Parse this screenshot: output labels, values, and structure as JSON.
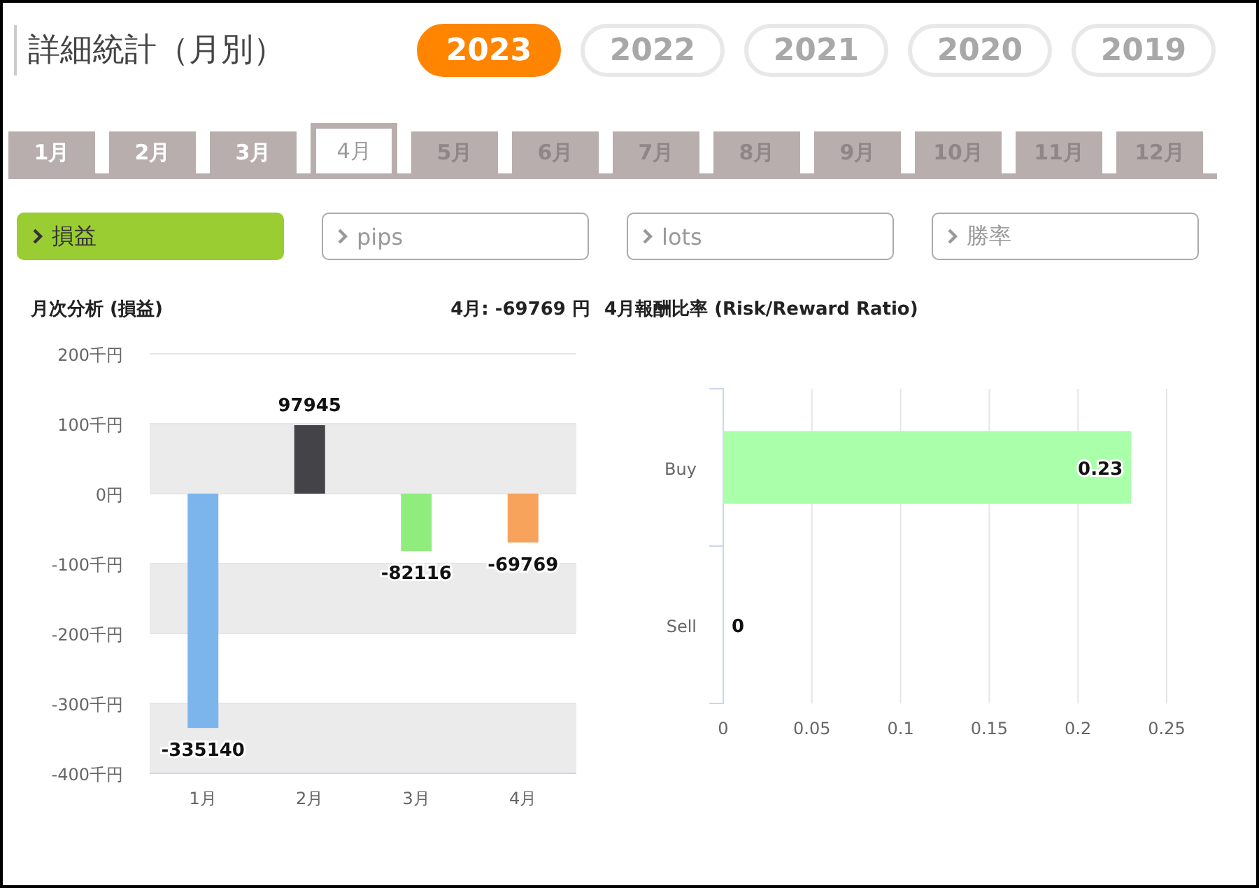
{
  "header": {
    "title": "詳細統計（月別）"
  },
  "years": [
    {
      "label": "2023",
      "selected": true
    },
    {
      "label": "2022",
      "selected": false
    },
    {
      "label": "2021",
      "selected": false
    },
    {
      "label": "2020",
      "selected": false
    },
    {
      "label": "2019",
      "selected": false
    }
  ],
  "month_tabs": [
    {
      "label": "1月",
      "selected": false,
      "disabled": false
    },
    {
      "label": "2月",
      "selected": false,
      "disabled": false
    },
    {
      "label": "3月",
      "selected": false,
      "disabled": false
    },
    {
      "label": "4月",
      "selected": true,
      "disabled": false
    },
    {
      "label": "5月",
      "selected": false,
      "disabled": true
    },
    {
      "label": "6月",
      "selected": false,
      "disabled": true
    },
    {
      "label": "7月",
      "selected": false,
      "disabled": true
    },
    {
      "label": "8月",
      "selected": false,
      "disabled": true
    },
    {
      "label": "9月",
      "selected": false,
      "disabled": true
    },
    {
      "label": "10月",
      "selected": false,
      "disabled": true
    },
    {
      "label": "11月",
      "selected": false,
      "disabled": true
    },
    {
      "label": "12月",
      "selected": false,
      "disabled": true
    }
  ],
  "metric_buttons": [
    {
      "label": "損益",
      "selected": true
    },
    {
      "label": "pips",
      "selected": false
    },
    {
      "label": "lots",
      "selected": false
    },
    {
      "label": "勝率",
      "selected": false
    }
  ],
  "monthly_panel": {
    "title": "月次分析 (損益)",
    "summary": "4月:  -69769 円",
    "chart_data": {
      "type": "bar",
      "categories": [
        "1月",
        "2月",
        "3月",
        "4月"
      ],
      "series": [
        {
          "values": [
            -335.14,
            97.945,
            -82.116,
            -69.769
          ]
        }
      ],
      "colors": [
        "#7cb5ec",
        "#434348",
        "#90ed7d",
        "#f7a35c"
      ],
      "ylim": [
        -400,
        200
      ],
      "yticks": [
        {
          "value": 200,
          "label": "200千円"
        },
        {
          "value": 100,
          "label": "100千円"
        },
        {
          "value": 0,
          "label": "0円"
        },
        {
          "value": -100,
          "label": "-100千円"
        },
        {
          "value": -200,
          "label": "-200千円"
        },
        {
          "value": -300,
          "label": "-300千円"
        },
        {
          "value": -400,
          "label": "-400千円"
        }
      ],
      "value_labels": [
        "-335140",
        "97945",
        "-82116",
        "-69769"
      ],
      "grid": true
    }
  },
  "ratio_panel": {
    "title": "4月報酬比率 (Risk/Reward Ratio)",
    "chart_data": {
      "type": "bar",
      "orientation": "horizontal",
      "categories": [
        "Buy",
        "Sell"
      ],
      "series": [
        {
          "color": "#aaffaa",
          "values": [
            0.23,
            0
          ]
        }
      ],
      "xlim": [
        0,
        0.25
      ],
      "xticks": [
        0,
        0.05,
        0.1,
        0.15,
        0.2,
        0.25
      ],
      "grid": true,
      "data_labels": true
    }
  }
}
